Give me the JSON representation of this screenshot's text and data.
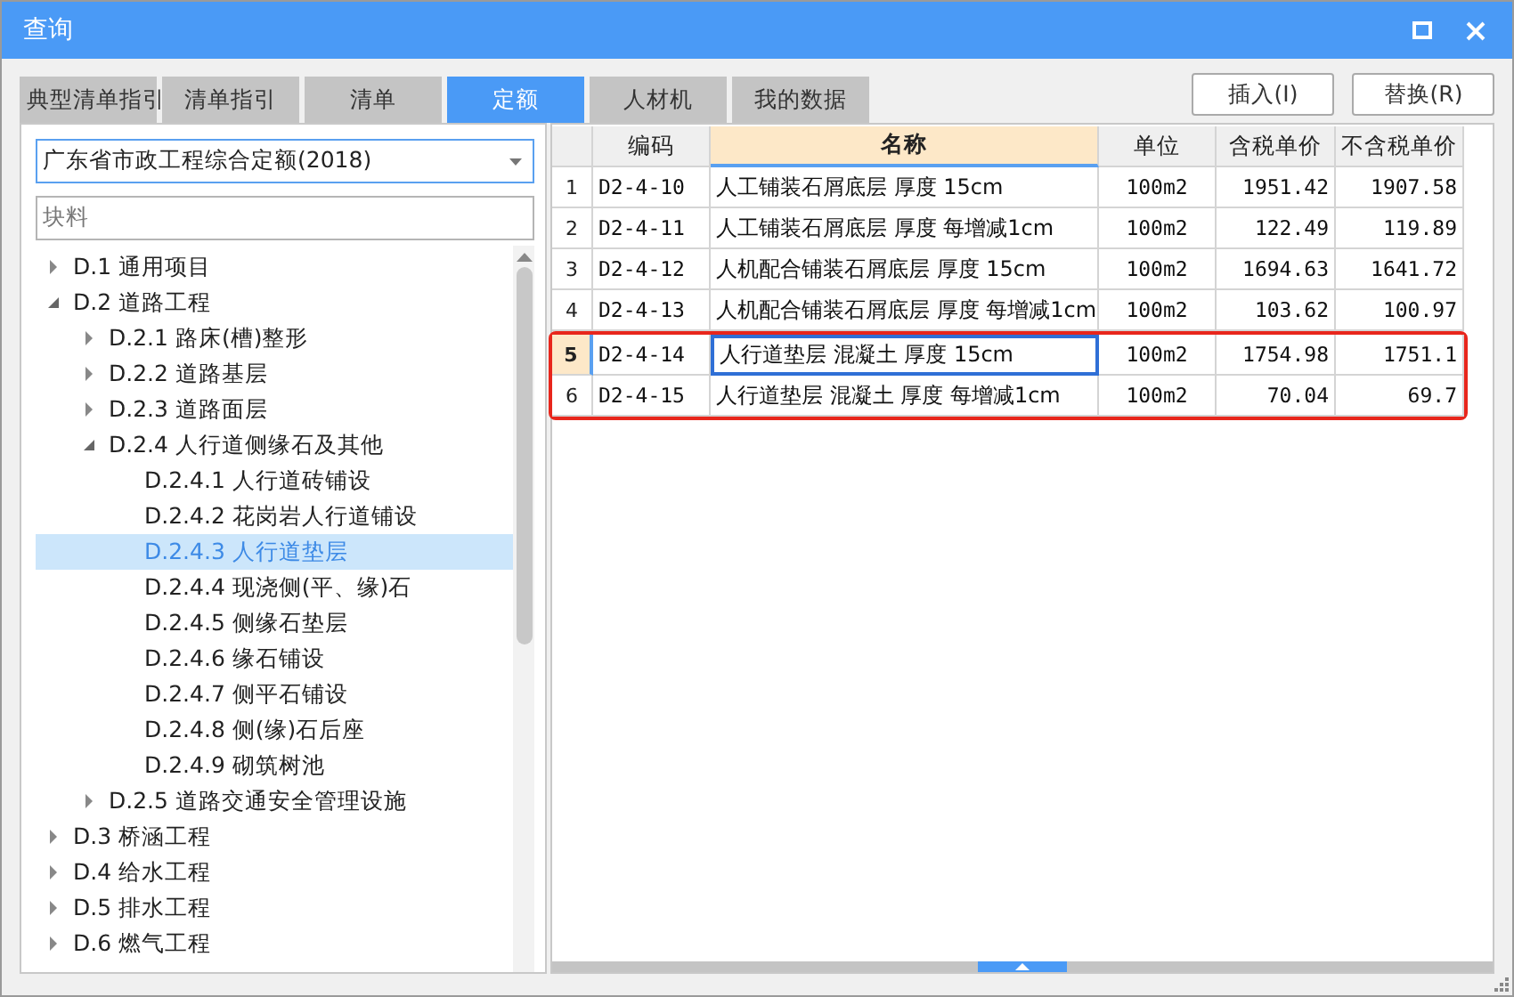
{
  "window": {
    "title": "查询"
  },
  "tabs": [
    {
      "label": "典型清单指引",
      "selected": false
    },
    {
      "label": "清单指引",
      "selected": false
    },
    {
      "label": "清单",
      "selected": false
    },
    {
      "label": "定额",
      "selected": true
    },
    {
      "label": "人材机",
      "selected": false
    },
    {
      "label": "我的数据",
      "selected": false
    }
  ],
  "buttons": [
    "插入(I)",
    "替换(R)"
  ],
  "library_select": {
    "value": "广东省市政工程综合定额(2018)"
  },
  "search": {
    "value": "块料"
  },
  "tree": [
    {
      "kind": "group",
      "label": "D.1 通用项目",
      "expanded": false,
      "selected": false
    },
    {
      "kind": "group",
      "label": "D.2 道路工程",
      "expanded": true,
      "selected": false,
      "children": [
        {
          "kind": "group",
          "label": "D.2.1 路床(槽)整形",
          "expanded": false,
          "selected": false
        },
        {
          "kind": "group",
          "label": "D.2.2 道路基层",
          "expanded": false,
          "selected": false
        },
        {
          "kind": "group",
          "label": "D.2.3 道路面层",
          "expanded": false,
          "selected": false
        },
        {
          "kind": "group",
          "label": "D.2.4 人行道侧缘石及其他",
          "expanded": true,
          "selected": false,
          "children": [
            {
              "kind": "leaf",
              "label": "D.2.4.1 人行道砖铺设",
              "selected": false
            },
            {
              "kind": "leaf",
              "label": "D.2.4.2 花岗岩人行道铺设",
              "selected": false
            },
            {
              "kind": "leaf",
              "label": "D.2.4.3 人行道垫层",
              "selected": true
            },
            {
              "kind": "leaf",
              "label": "D.2.4.4 现浇侧(平、缘)石",
              "selected": false
            },
            {
              "kind": "leaf",
              "label": "D.2.4.5 侧缘石垫层",
              "selected": false
            },
            {
              "kind": "leaf",
              "label": "D.2.4.6 缘石铺设",
              "selected": false
            },
            {
              "kind": "leaf",
              "label": "D.2.4.7 侧平石铺设",
              "selected": false
            },
            {
              "kind": "leaf",
              "label": "D.2.4.8 侧(缘)石后座",
              "selected": false
            },
            {
              "kind": "leaf",
              "label": "D.2.4.9 砌筑树池",
              "selected": false
            }
          ]
        },
        {
          "kind": "group",
          "label": "D.2.5 道路交通安全管理设施",
          "expanded": false,
          "selected": false
        }
      ]
    },
    {
      "kind": "group",
      "label": "D.3 桥涵工程",
      "expanded": false,
      "selected": false
    },
    {
      "kind": "group",
      "label": "D.4 给水工程",
      "expanded": false,
      "selected": false
    },
    {
      "kind": "group",
      "label": "D.5 排水工程",
      "expanded": false,
      "selected": false
    },
    {
      "kind": "group",
      "label": "D.6 燃气工程",
      "expanded": false,
      "selected": false
    }
  ],
  "table": {
    "columns": [
      "编码",
      "名称",
      "单位",
      "含税单价",
      "不含税单价"
    ],
    "rows": [
      {
        "index": "1",
        "code": "D2-4-10",
        "name": "人工铺装石屑底层 厚度 15cm",
        "unit": "100m2",
        "tax_price": "1951.42",
        "net_price": "1907.58",
        "selected": false,
        "marked": false
      },
      {
        "index": "2",
        "code": "D2-4-11",
        "name": "人工铺装石屑底层 厚度 每增减1cm",
        "unit": "100m2",
        "tax_price": "122.49",
        "net_price": "119.89",
        "selected": false,
        "marked": false
      },
      {
        "index": "3",
        "code": "D2-4-12",
        "name": "人机配合铺装石屑底层 厚度 15cm",
        "unit": "100m2",
        "tax_price": "1694.63",
        "net_price": "1641.72",
        "selected": false,
        "marked": false
      },
      {
        "index": "4",
        "code": "D2-4-13",
        "name": "人机配合铺装石屑底层 厚度 每增减1cm",
        "unit": "100m2",
        "tax_price": "103.62",
        "net_price": "100.97",
        "selected": false,
        "marked": false
      },
      {
        "index": "5",
        "code": "D2-4-14",
        "name": "人行道垫层 混凝土 厚度 15cm",
        "unit": "100m2",
        "tax_price": "1754.98",
        "net_price": "1751.1",
        "selected": true,
        "marked": true
      },
      {
        "index": "6",
        "code": "D2-4-15",
        "name": "人行道垫层 混凝土 厚度 每增减1cm",
        "unit": "100m2",
        "tax_price": "70.04",
        "net_price": "69.7",
        "selected": false,
        "marked": true
      }
    ]
  }
}
